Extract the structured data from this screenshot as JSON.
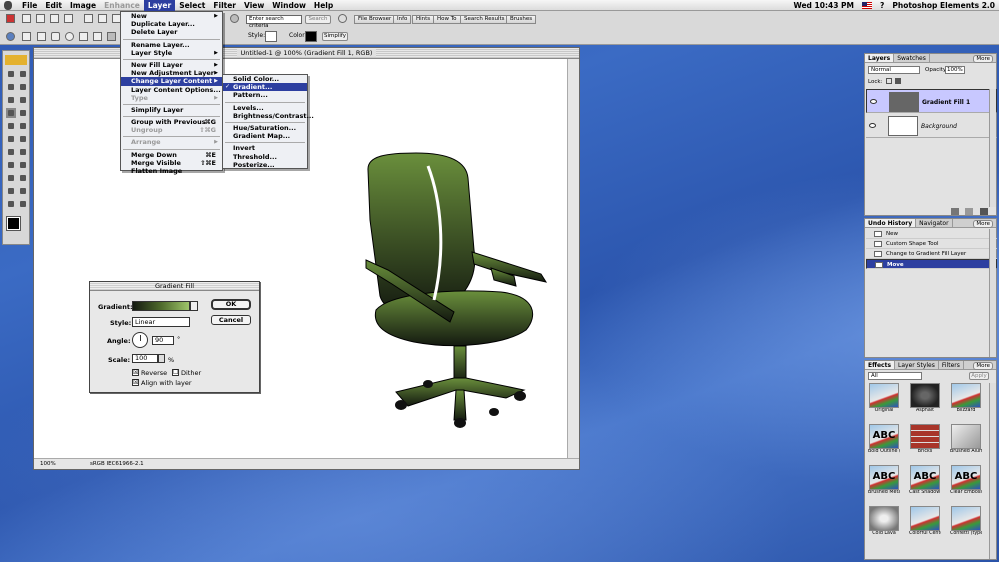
{
  "menubar": {
    "items": [
      "File",
      "Edit",
      "Image",
      "Enhance",
      "Layer",
      "Select",
      "Filter",
      "View",
      "Window",
      "Help"
    ],
    "active": "Layer",
    "disabled": "Enhance",
    "clock": "Wed 10:43 PM",
    "app": "Photoshop Elements 2.0"
  },
  "optionbar": {
    "search_placeholder": "Enter search criteria",
    "search_button": "Search",
    "palettes": [
      "File Browser",
      "Info",
      "Hints",
      "How To",
      "Search Results",
      "Brushes"
    ],
    "style_label": "Style:",
    "color_label": "Color:",
    "simplify": "Simplify"
  },
  "document": {
    "title": "Untitled-1 @ 100% (Gradient Fill 1, RGB)",
    "zoom": "100%",
    "profile": "sRGB IEC61966-2.1"
  },
  "layer_menu": [
    {
      "label": "New",
      "arrow": true
    },
    {
      "label": "Duplicate Layer..."
    },
    {
      "label": "Delete Layer"
    },
    {
      "sep": true
    },
    {
      "label": "Rename Layer..."
    },
    {
      "label": "Layer Style",
      "arrow": true
    },
    {
      "sep": true
    },
    {
      "label": "New Fill Layer",
      "arrow": true
    },
    {
      "label": "New Adjustment Layer",
      "arrow": true
    },
    {
      "label": "Change Layer Content",
      "arrow": true,
      "hl": true
    },
    {
      "label": "Layer Content Options..."
    },
    {
      "label": "Type",
      "arrow": true,
      "dis": true
    },
    {
      "sep": true
    },
    {
      "label": "Simplify Layer"
    },
    {
      "sep": true
    },
    {
      "label": "Group with Previous",
      "sc": "⌘G"
    },
    {
      "label": "Ungroup",
      "sc": "⇧⌘G",
      "dis": true
    },
    {
      "sep": true
    },
    {
      "label": "Arrange",
      "arrow": true,
      "dis": true
    },
    {
      "sep": true
    },
    {
      "label": "Merge Down",
      "sc": "⌘E"
    },
    {
      "label": "Merge Visible",
      "sc": "⇧⌘E"
    },
    {
      "label": "Flatten Image"
    }
  ],
  "submenu": [
    {
      "label": "Solid Color..."
    },
    {
      "label": "Gradient...",
      "hl": true,
      "check": "✓"
    },
    {
      "label": "Pattern..."
    },
    {
      "sep": true
    },
    {
      "label": "Levels..."
    },
    {
      "label": "Brightness/Contrast..."
    },
    {
      "sep": true
    },
    {
      "label": "Hue/Saturation..."
    },
    {
      "label": "Gradient Map..."
    },
    {
      "sep": true
    },
    {
      "label": "Invert"
    },
    {
      "label": "Threshold..."
    },
    {
      "label": "Posterize..."
    }
  ],
  "gradient_dialog": {
    "title": "Gradient Fill",
    "gradient_label": "Gradient:",
    "style_label": "Style:",
    "style_value": "Linear",
    "angle_label": "Angle:",
    "angle_value": "90",
    "degree": "°",
    "scale_label": "Scale:",
    "scale_value": "100",
    "percent": "%",
    "ok": "OK",
    "cancel": "Cancel",
    "reverse": "Reverse",
    "dither": "Dither",
    "align": "Align with layer",
    "reverse_checked": "☒",
    "dither_checked": "☐",
    "align_checked": "☒"
  },
  "layers_panel": {
    "tabs": [
      "Layers",
      "Swatches"
    ],
    "more": "More",
    "blend": "Normal",
    "opacity_label": "Opacity:",
    "opacity_value": "100%",
    "lock_label": "Lock:",
    "layers": [
      "Gradient Fill 1",
      "Background"
    ]
  },
  "history_panel": {
    "tabs": [
      "Undo History",
      "Navigator"
    ],
    "more": "More",
    "items": [
      "New",
      "Custom Shape Tool",
      "Change to Gradient Fill Layer",
      "Move"
    ]
  },
  "effects_panel": {
    "tabs": [
      "Effects",
      "Layer Styles",
      "Filters"
    ],
    "more": "More",
    "filter": "All",
    "apply": "Apply",
    "items": [
      "Original",
      "Asphalt",
      "Blizzard",
      "Bold Outline (t...",
      "Bricks",
      "Brushed Alumi...",
      "Brushed Metal ...",
      "Cast Shadow (...",
      "Clear Emboss (...",
      "Cold Lava",
      "Colorful Center",
      "Confetti (type)"
    ],
    "abc": "ABC"
  },
  "colors": {
    "accent": "#2d3fa0",
    "chair_top": "#6a8f3c",
    "chair_bottom": "#141a10"
  }
}
